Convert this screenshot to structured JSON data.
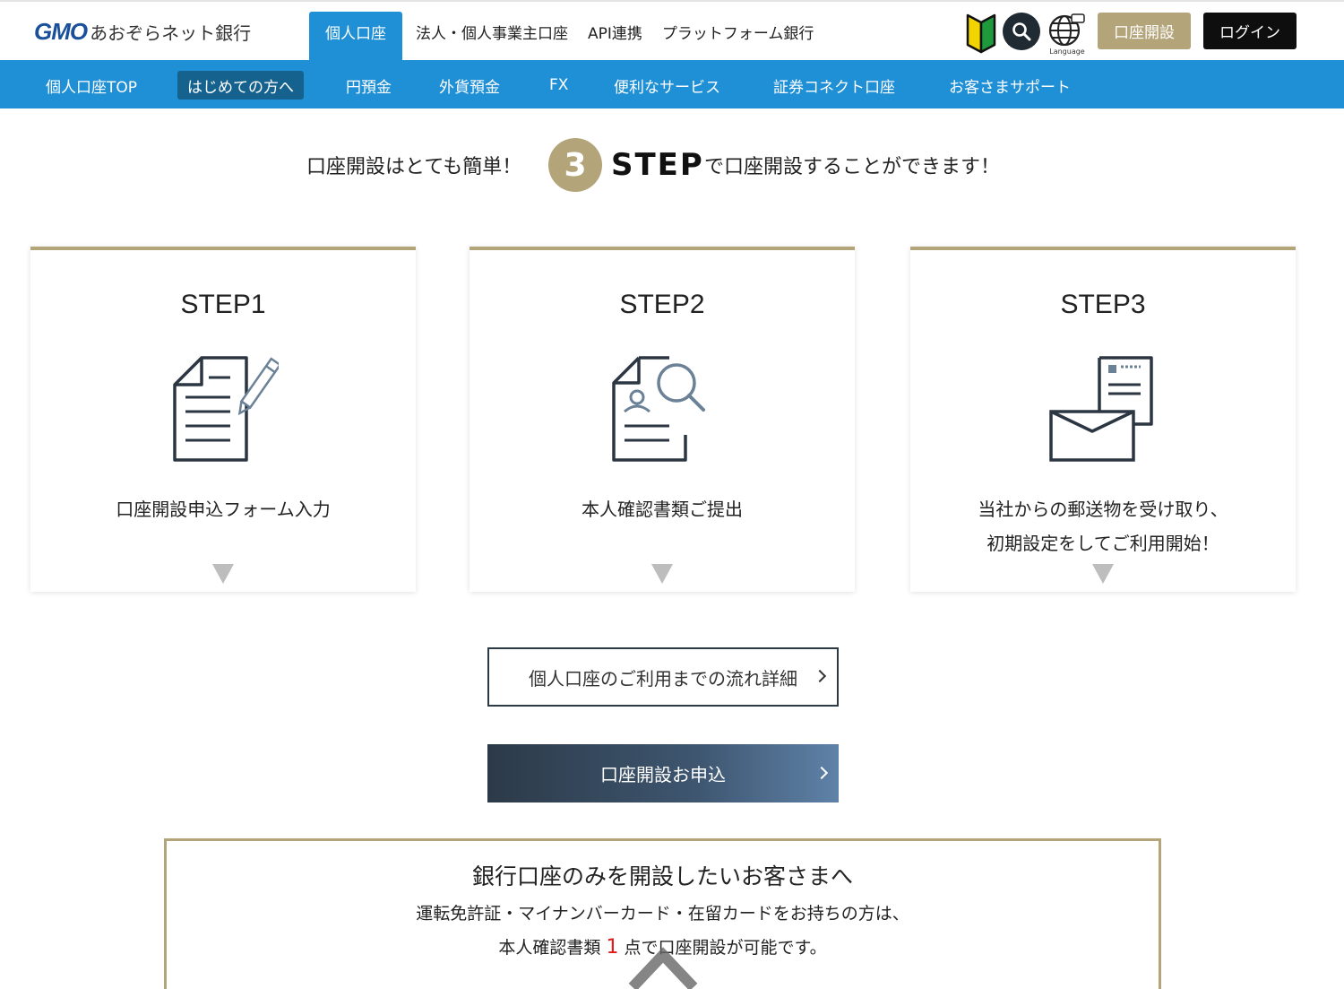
{
  "header": {
    "logo_mark": "GMO",
    "logo_name": "あおぞらネット銀行",
    "tabs": [
      {
        "label": "個人口座",
        "active": true
      },
      {
        "label": "法人・個人事業主口座"
      },
      {
        "label": "API連携"
      },
      {
        "label": "プラットフォーム銀行"
      }
    ],
    "language_label": "Language",
    "open_account_label": "口座開設",
    "login_label": "ログイン"
  },
  "subnav": {
    "items": [
      {
        "label": "個人口座TOP"
      },
      {
        "label": "はじめての方へ",
        "active": true
      },
      {
        "label": "円預金"
      },
      {
        "label": "外貨預金"
      },
      {
        "label": "FX"
      },
      {
        "label": "便利なサービス"
      },
      {
        "label": "証券コネクト口座"
      },
      {
        "label": "お客さまサポート"
      }
    ]
  },
  "headline": {
    "left": "口座開設はとても簡単！",
    "number": "3",
    "step_word": "STEP",
    "right": "で口座開設することができます！"
  },
  "steps": [
    {
      "title": "STEP1",
      "icon": "form-pen-icon",
      "text_lines": [
        "口座開設申込フォーム入力"
      ]
    },
    {
      "title": "STEP2",
      "icon": "id-document-search-icon",
      "text_lines": [
        "本人確認書類ご提出"
      ]
    },
    {
      "title": "STEP3",
      "icon": "mail-envelope-icon",
      "text_lines": [
        "当社からの郵送物を受け取り、",
        "初期設定をしてご利用開始！"
      ]
    }
  ],
  "buttons": {
    "flow_detail": "個人口座のご利用までの流れ詳細",
    "apply": "口座開設お申込"
  },
  "info": {
    "title": "銀行口座のみを開設したいお客さまへ",
    "line1": "運転免許証・マイナンバーカード・在留カードをお持ちの方は、",
    "line2_pre": "本人確認書類",
    "line2_num": "1",
    "line2_post": "点で口座開設が可能です。"
  },
  "colors": {
    "brand_blue": "#1f8fd6",
    "gold": "#b4a47a",
    "highlight_red": "#e0191b"
  }
}
